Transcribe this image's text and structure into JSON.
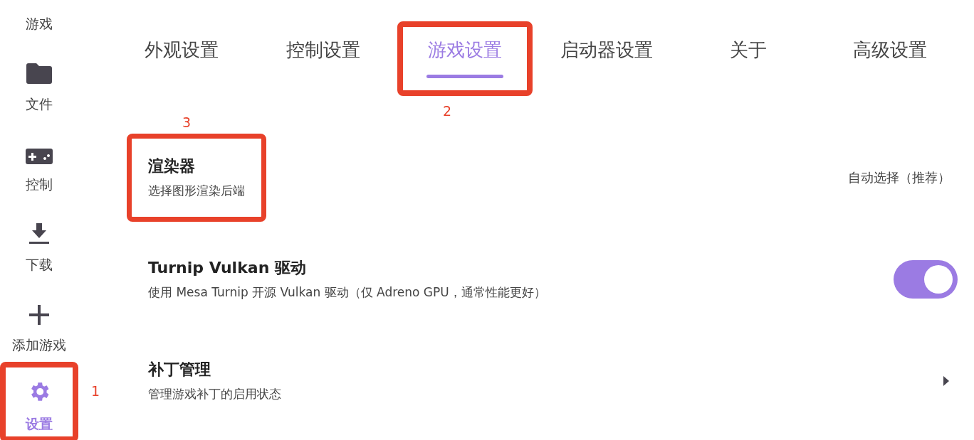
{
  "sidebar": {
    "items": [
      {
        "label": "游戏",
        "kind": "partial",
        "selected": false
      },
      {
        "label": "文件",
        "kind": "folder",
        "selected": false
      },
      {
        "label": "控制",
        "kind": "gamepad",
        "selected": false
      },
      {
        "label": "下载",
        "kind": "download",
        "selected": false
      },
      {
        "label": "添加游戏",
        "kind": "plus",
        "selected": false
      },
      {
        "label": "设置",
        "kind": "gear",
        "selected": true,
        "callout": "1"
      }
    ]
  },
  "tabs": [
    {
      "label": "外观设置",
      "selected": false
    },
    {
      "label": "控制设置",
      "selected": false
    },
    {
      "label": "游戏设置",
      "selected": true,
      "callout": "2"
    },
    {
      "label": "启动器设置",
      "selected": false
    },
    {
      "label": "关于",
      "selected": false
    },
    {
      "label": "高级设置",
      "selected": false
    }
  ],
  "settings": [
    {
      "kind": "value",
      "title": "渲染器",
      "subtitle": "选择图形渲染后端",
      "value": "自动选择（推荐）",
      "callout": "3"
    },
    {
      "kind": "toggle",
      "title": "Turnip Vulkan 驱动",
      "subtitle": "使用 Mesa Turnip 开源 Vulkan 驱动（仅 Adreno GPU，通常性能更好）",
      "on": true
    },
    {
      "kind": "link",
      "title": "补丁管理",
      "subtitle": "管理游戏补丁的启用状态"
    }
  ]
}
